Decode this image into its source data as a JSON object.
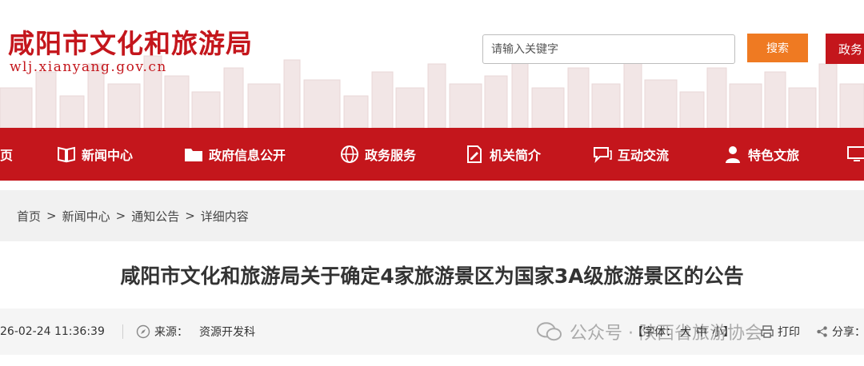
{
  "header": {
    "title": "咸阳市文化和旅游局",
    "domain": "wlj.xianyang.gov.cn",
    "search_placeholder": "请输入关键字",
    "search_button": "搜索",
    "gov_button": "政务"
  },
  "nav": {
    "items": [
      {
        "label": "页",
        "icon": "home-icon"
      },
      {
        "label": "新闻中心",
        "icon": "book-icon"
      },
      {
        "label": "政府信息公开",
        "icon": "folder-icon"
      },
      {
        "label": "政务服务",
        "icon": "globe-icon"
      },
      {
        "label": "机关简介",
        "icon": "document-pen-icon"
      },
      {
        "label": "互动交流",
        "icon": "chat-icon"
      },
      {
        "label": "特色文旅",
        "icon": "person-icon"
      }
    ]
  },
  "breadcrumb": {
    "prefix": "：",
    "items": [
      "首页",
      "新闻中心",
      "通知公告",
      "详细内容"
    ],
    "separator": ">"
  },
  "article": {
    "title": "咸阳市文化和旅游局关于确定4家旅游景区为国家3A级旅游景区的公告"
  },
  "meta": {
    "date": "26-02-24 11:36:39",
    "source_label": "来源：",
    "source_value": "资源开发科",
    "font_label": "【字体：",
    "font_sizes": [
      "大",
      "中",
      "小"
    ],
    "font_close": "】",
    "print_label": "打印",
    "share_label": "分享：",
    "watermark": "公众号 · 陕西省旅游协会"
  },
  "colors": {
    "brand_red": "#c4161c",
    "search_orange": "#ef7a22",
    "crumb_bg": "#f1f1f1"
  }
}
